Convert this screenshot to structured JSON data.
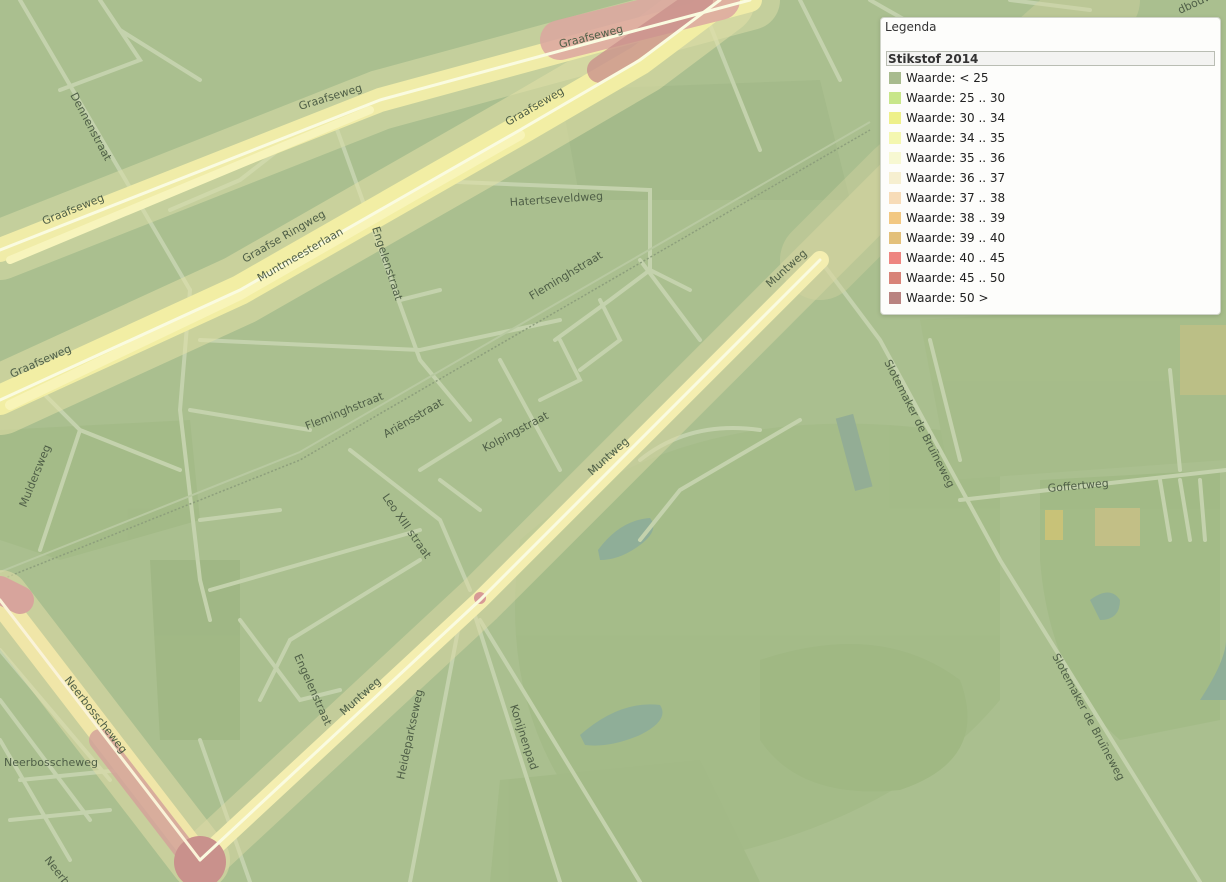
{
  "legend": {
    "title": "Legenda",
    "layer": "Stikstof 2014",
    "items": [
      {
        "label": "Waarde: < 25",
        "color": "#a8bb8e"
      },
      {
        "label": "Waarde: 25 .. 30",
        "color": "#c8e68a"
      },
      {
        "label": "Waarde: 30 .. 34",
        "color": "#eef08a"
      },
      {
        "label": "Waarde: 34 .. 35",
        "color": "#f4f7b0"
      },
      {
        "label": "Waarde: 35 .. 36",
        "color": "#f7f8d2"
      },
      {
        "label": "Waarde: 36 .. 37",
        "color": "#f6efd0"
      },
      {
        "label": "Waarde: 37 .. 38",
        "color": "#f7dcb8"
      },
      {
        "label": "Waarde: 38 .. 39",
        "color": "#f2c882"
      },
      {
        "label": "Waarde: 39 .. 40",
        "color": "#e3c07a"
      },
      {
        "label": "Waarde: 40 .. 45",
        "color": "#ee8580"
      },
      {
        "label": "Waarde: 45 .. 50",
        "color": "#d88378"
      },
      {
        "label": "Waarde: 50 >",
        "color": "#b98380"
      }
    ]
  },
  "streets": {
    "graafseweg_1": "Graafseweg",
    "graafseweg_2": "Graafseweg",
    "graafseweg_3": "Graafseweg",
    "graafseweg_4": "Graafseweg",
    "graafseweg_5": "Graafseweg",
    "dennenstraat": "Dennenstraat",
    "graafse_ringweg": "Graafse Ringweg",
    "muntmeesterlaan": "Muntmeesterlaan",
    "engelenstraat_1": "Engelenstraat",
    "engelenstraat_2": "Engelenstraat",
    "hatertseveldweg": "Hatertseveldweg",
    "fleminghstraat_1": "Fleminghstraat",
    "fleminghstraat_2": "Fleminghstraat",
    "muntweg_1": "Muntweg",
    "muntweg_2": "Muntweg",
    "muntweg_3": "Muntweg",
    "ariensstraat": "Ariënsstraat",
    "kolpingstraat": "Kolpingstraat",
    "leo_xiii_straat": "Leo XIII straat",
    "muldersweg": "Muldersweg",
    "slotemaker_1": "Slotemaker de Bruïneweg",
    "slotemaker_2": "Slotemaker de Bruïneweg",
    "goffertweg": "Goffertweg",
    "neerbosscheweg_1": "Neerbosscheweg",
    "neerbosscheweg_2": "Neerbosscheweg",
    "neerbosscheweg_3": "Neerb",
    "heideparkseweg": "Heideparkseweg",
    "konijnenpad": "Konijnenpad",
    "dbouw": "dbouw"
  }
}
